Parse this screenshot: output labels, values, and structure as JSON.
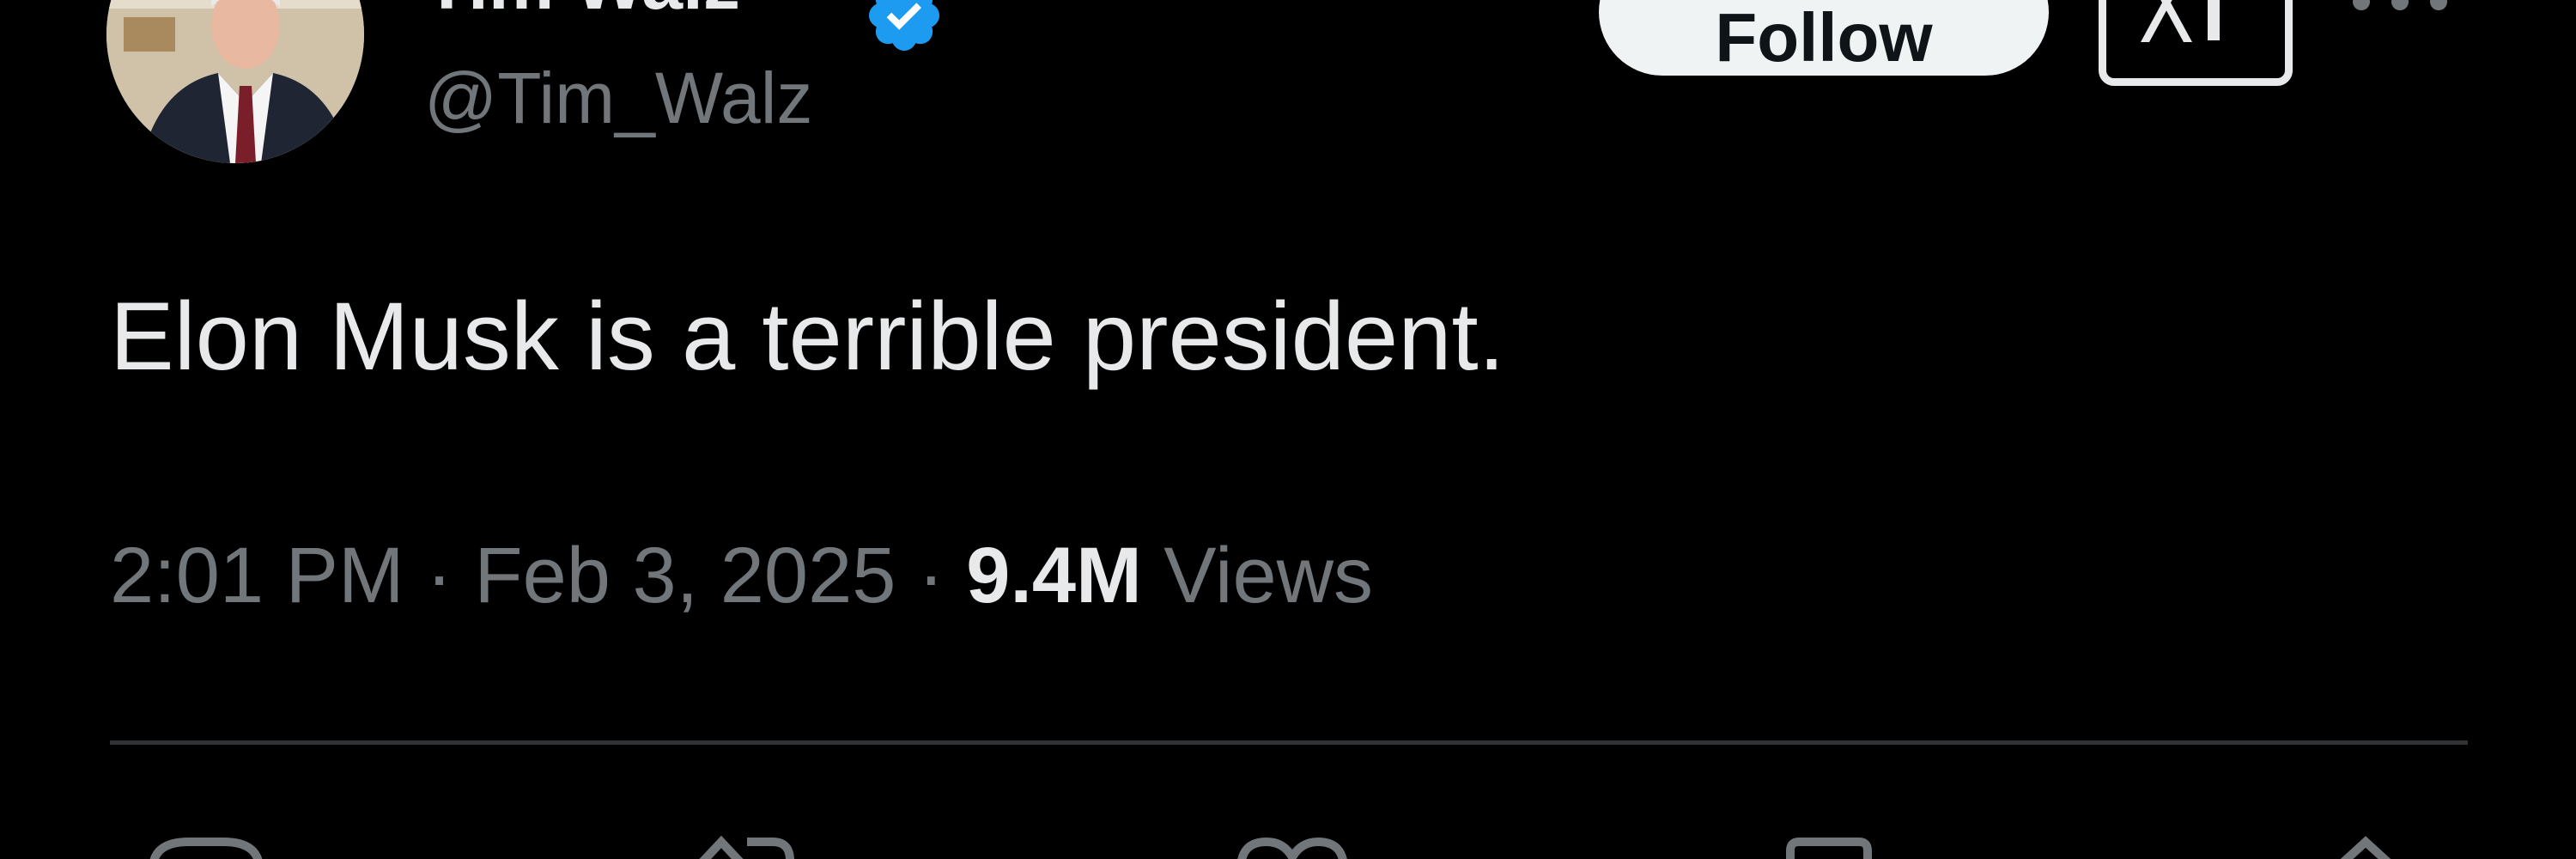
{
  "author": {
    "display_name": "Tim Walz",
    "handle": "@Tim_Walz",
    "verified": true,
    "avatar_icon": "profile-photo"
  },
  "header": {
    "follow_label": "Follow",
    "grok_icon": "x-logo-icon",
    "more_icon": "more-horizontal-icon"
  },
  "tweet": {
    "text": "Elon Musk is a terrible president.",
    "time": "2:01 PM",
    "separator": "·",
    "date": "Feb 3, 2025",
    "views_count": "9.4M",
    "views_label": "Views"
  },
  "actions": [
    {
      "icon": "reply-icon"
    },
    {
      "icon": "repost-icon"
    },
    {
      "icon": "like-icon"
    },
    {
      "icon": "bookmark-icon"
    },
    {
      "icon": "share-icon"
    }
  ],
  "colors": {
    "background": "#000000",
    "primary_text": "#e7e9ea",
    "secondary_text": "#71767b",
    "verified_blue": "#1d9bf0",
    "divider": "#2f3336",
    "follow_bg": "#eff3f4"
  }
}
